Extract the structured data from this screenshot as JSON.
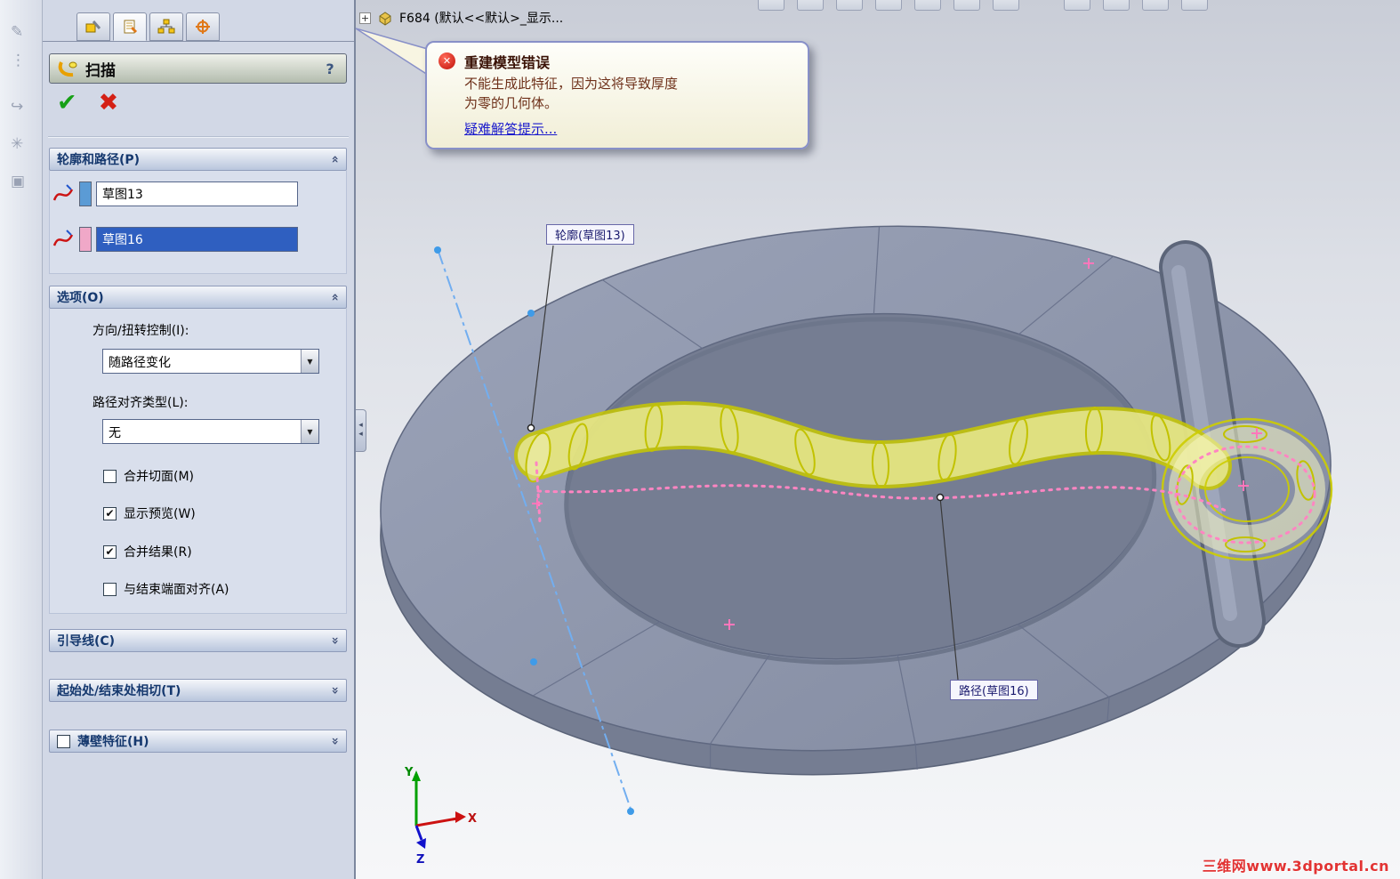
{
  "icons": {
    "confirm": "✔",
    "cancel": "✖",
    "help": "?",
    "dropdown_arrow": "▼",
    "chevron_up": "«",
    "chevron_down": "»",
    "tree_expand": "+",
    "checkmark": "✔",
    "splitter_arrow": "◂",
    "error_x": "✕"
  },
  "colors": {
    "selection": "#2f5fc0",
    "profile_swatch": "#5b9bd5",
    "path_swatch": "#f0a8c8",
    "preview_yellow": "#d9d900",
    "path_pink": "#ff85c2",
    "watermark_red": "#e23333"
  },
  "left_toolbar": {
    "icons": [
      "✎",
      "⋮",
      "↪",
      "✳",
      "▣"
    ]
  },
  "property_manager": {
    "title": "扫描",
    "profile_path": {
      "header": "轮廓和路径(P)",
      "profile_value": "草图13",
      "profile_selected": false,
      "path_value": "草图16",
      "path_selected": true
    },
    "options": {
      "header": "选项(O)",
      "orientation_label": "方向/扭转控制(I):",
      "orientation_value": "随路径变化",
      "align_label": "路径对齐类型(L):",
      "align_value": "无",
      "checkboxes": [
        {
          "label": "合并切面(M)",
          "checked": false
        },
        {
          "label": "显示预览(W)",
          "checked": true
        },
        {
          "label": "合并结果(R)",
          "checked": true
        },
        {
          "label": "与结束端面对齐(A)",
          "checked": false
        }
      ]
    },
    "guide_curves_header": "引导线(C)",
    "tangency_header": "起始处/结束处相切(T)",
    "thin_feature_header": "薄壁特征(H)",
    "thin_feature_checked": false
  },
  "viewport": {
    "tree_item": "F684 (默认<<默认>_显示...",
    "error_balloon": {
      "title": "重建模型错误",
      "line1": "不能生成此特征，因为这将导致厚度",
      "line2": "为零的几何体。",
      "link": "疑难解答提示..."
    },
    "callout_profile": "轮廓(草图13)",
    "callout_path": "路径(草图16)",
    "triad": {
      "x": "X",
      "y": "Y",
      "z": "Z"
    },
    "watermark": "三维网www.3dportal.cn"
  }
}
